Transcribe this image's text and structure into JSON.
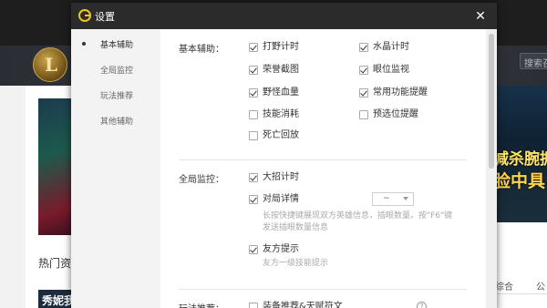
{
  "background": {
    "logo_letter": "L",
    "search_placeholder": "搜索召",
    "banner_line1": "减杀腕拥",
    "banner_line2": "脸中具",
    "section_title": "热门资讯",
    "thumb_text": "秀妮我",
    "tab_1": "综合",
    "tab_2": "公"
  },
  "dialog": {
    "title": "设置",
    "close_glyph": "✕",
    "sidebar": [
      {
        "label": "基本辅助",
        "active": true
      },
      {
        "label": "全局监控",
        "active": false
      },
      {
        "label": "玩法推荐",
        "active": false
      },
      {
        "label": "其他辅助",
        "active": false
      }
    ],
    "sections": {
      "basic": {
        "label": "基本辅助：",
        "options": [
          {
            "label": "打野计时",
            "checked": true
          },
          {
            "label": "水晶计时",
            "checked": true
          },
          {
            "label": "荣誉截图",
            "checked": true
          },
          {
            "label": "眼位监视",
            "checked": true
          },
          {
            "label": "野怪血量",
            "checked": true
          },
          {
            "label": "常用功能提醒",
            "checked": true
          },
          {
            "label": "技能消耗",
            "checked": false
          },
          {
            "label": "预选位提醒",
            "checked": false
          },
          {
            "label": "死亡回放",
            "checked": false
          }
        ]
      },
      "global": {
        "label": "全局监控：",
        "ult_timer": {
          "label": "大招计时",
          "checked": true
        },
        "match_detail": {
          "label": "对局详情",
          "checked": true
        },
        "select_value": "~",
        "match_hint_1": "长按快捷键展现双方英雄信息，插眼数量。按\"F6\"键",
        "match_hint_2": "发送插眼数量信息",
        "ally_tip": {
          "label": "友方提示",
          "checked": true
        },
        "ally_hint": "友方一级技能提示"
      },
      "recommend": {
        "label": "玩法推荐：",
        "equip": {
          "label": "装备推荐&天赋符文",
          "checked": false
        },
        "help_glyph": "?"
      }
    }
  }
}
